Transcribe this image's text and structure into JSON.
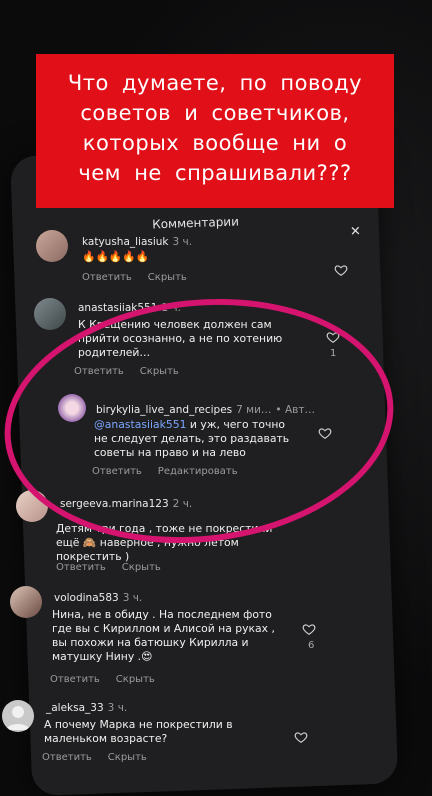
{
  "banner": {
    "lines": [
      "Что думаете, по поводу",
      "советов и советчиков,",
      "которых вообще ни о",
      "чем не спрашивали???"
    ]
  },
  "sheet": {
    "title": "Комментарии",
    "close_icon": "close-x"
  },
  "actions": {
    "reply": "Ответить",
    "hide": "Скрыть",
    "edit": "Редактировать"
  },
  "comments": [
    {
      "user": "katyusha_liasiuk",
      "time": "3 ч.",
      "text": "🔥🔥🔥🔥🔥"
    },
    {
      "user": "anastasiiak551",
      "time": "1 ч.",
      "text": "К Крещению человек должен сам прийти осознанно, а не по хотению родителей…",
      "likes": "1"
    },
    {
      "user": "birykylia_live_and_recipes",
      "time": "7 ми…",
      "badge": "• Авт…",
      "mention": "@anastasiiak551",
      "text": " и уж, чего точно не следует делать, это раздавать советы на право и на лево"
    },
    {
      "user": "sergeeva.marina123",
      "time": "2 ч.",
      "text": "Детям три года , тоже не покрестили ещё 🙈 наверное , нужно летом покрестить )"
    },
    {
      "user": "volodina583",
      "time": "3 ч.",
      "text": "Нина, не в обиду . На последнем фото где вы с Кириллом и Алисой на руках , вы похожи на батюшку Кирилла и матушку Нину .😍",
      "likes": "6"
    },
    {
      "user": "_aleksa_33",
      "time": "3 ч.",
      "text": "А почему Марка не покрестили в маленьком возрасте?"
    }
  ]
}
